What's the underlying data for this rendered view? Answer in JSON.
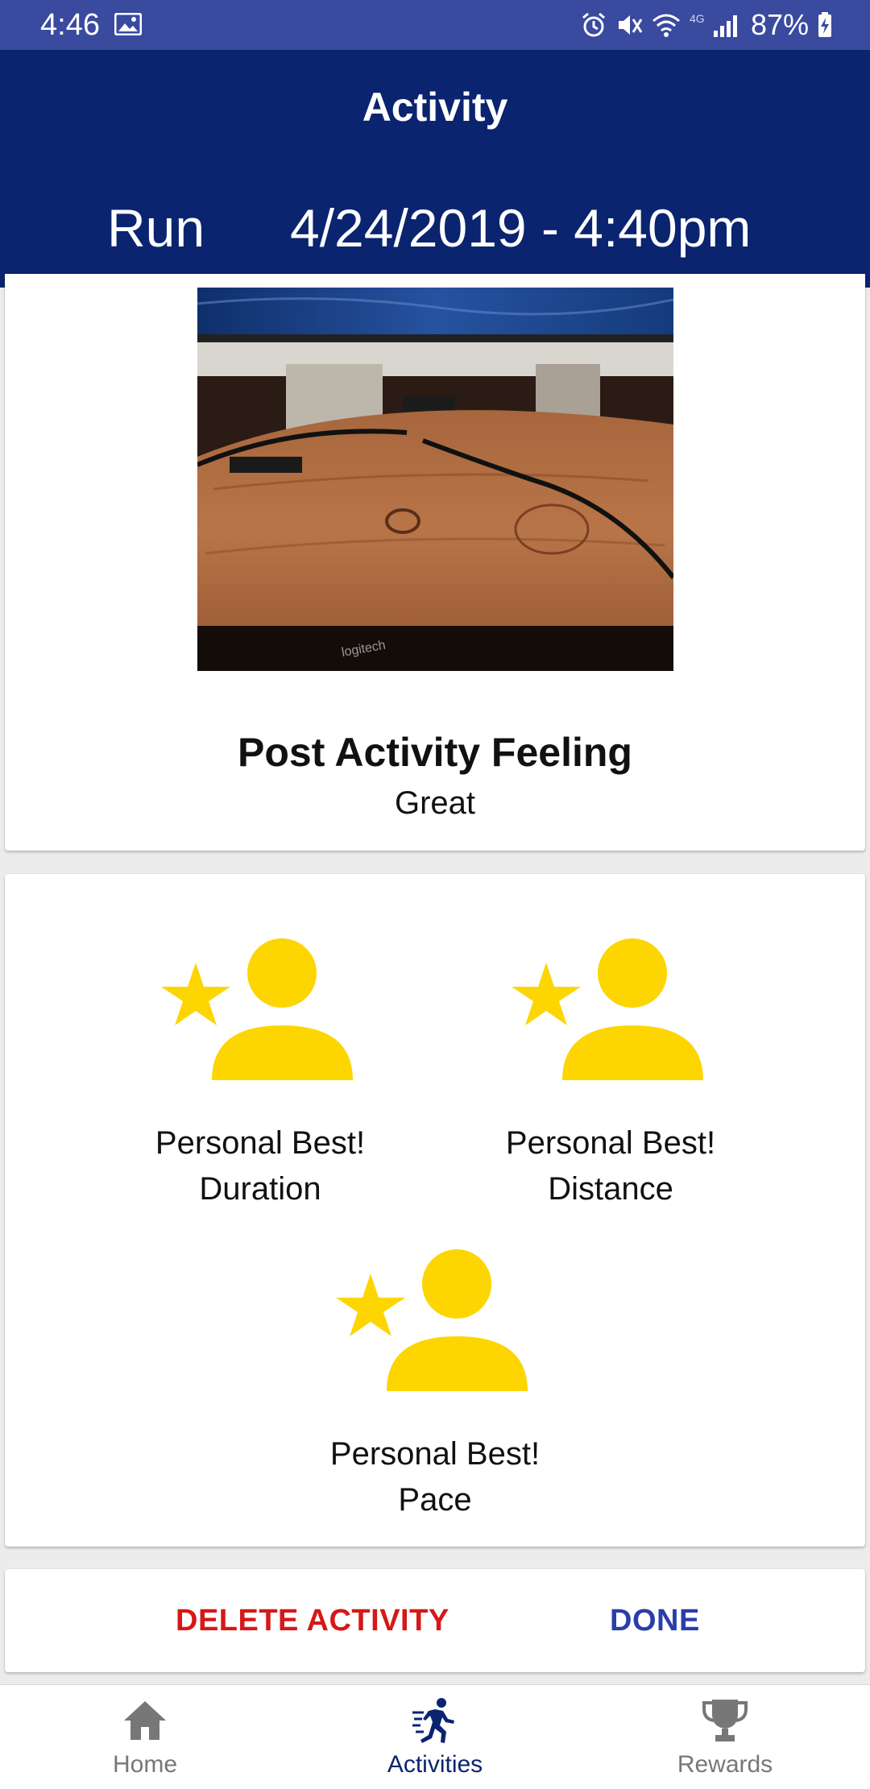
{
  "status_bar": {
    "time": "4:46",
    "battery": "87%"
  },
  "header": {
    "title": "Activity",
    "activity_type": "Run",
    "datetime": "4/24/2019 - 4:40pm"
  },
  "photo_card": {
    "feeling_title": "Post Activity Feeling",
    "feeling_value": "Great"
  },
  "awards": [
    {
      "title": "Personal Best!",
      "metric": "Duration"
    },
    {
      "title": "Personal Best!",
      "metric": "Distance"
    },
    {
      "title": "Personal Best!",
      "metric": "Pace"
    }
  ],
  "actions": {
    "delete_label": "DELETE ACTIVITY",
    "done_label": "DONE"
  },
  "bottom_nav": {
    "items": [
      {
        "label": "Home",
        "icon": "home-icon"
      },
      {
        "label": "Activities",
        "icon": "running-icon",
        "active": true
      },
      {
        "label": "Rewards",
        "icon": "trophy-icon"
      }
    ]
  },
  "colors": {
    "header": "#0b2470",
    "status_bar": "#3a4a9f",
    "award_gold": "#fdd500",
    "delete": "#d61818",
    "done": "#2a3ea8"
  }
}
